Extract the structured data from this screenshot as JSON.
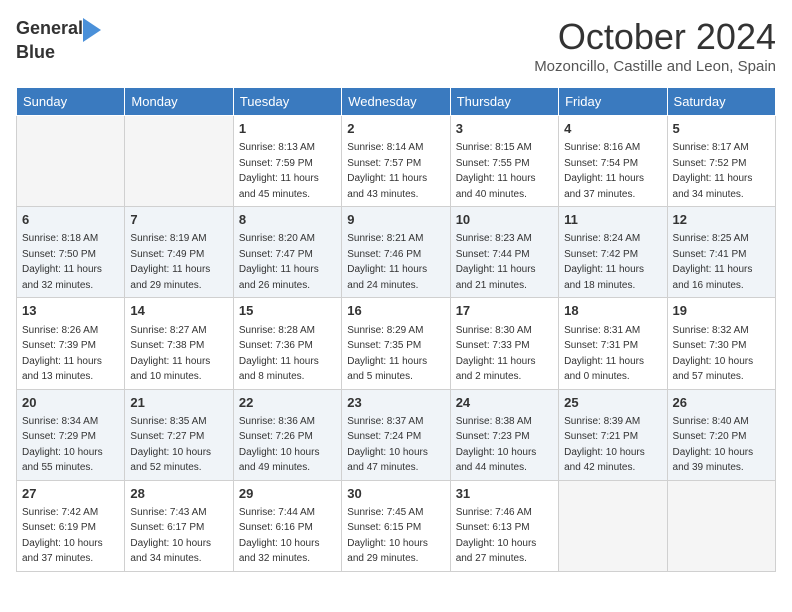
{
  "header": {
    "logo_line1": "General",
    "logo_line2": "Blue",
    "month": "October 2024",
    "location": "Mozoncillo, Castille and Leon, Spain"
  },
  "weekdays": [
    "Sunday",
    "Monday",
    "Tuesday",
    "Wednesday",
    "Thursday",
    "Friday",
    "Saturday"
  ],
  "weeks": [
    [
      {
        "day": "",
        "info": ""
      },
      {
        "day": "",
        "info": ""
      },
      {
        "day": "1",
        "info": "Sunrise: 8:13 AM\nSunset: 7:59 PM\nDaylight: 11 hours and 45 minutes."
      },
      {
        "day": "2",
        "info": "Sunrise: 8:14 AM\nSunset: 7:57 PM\nDaylight: 11 hours and 43 minutes."
      },
      {
        "day": "3",
        "info": "Sunrise: 8:15 AM\nSunset: 7:55 PM\nDaylight: 11 hours and 40 minutes."
      },
      {
        "day": "4",
        "info": "Sunrise: 8:16 AM\nSunset: 7:54 PM\nDaylight: 11 hours and 37 minutes."
      },
      {
        "day": "5",
        "info": "Sunrise: 8:17 AM\nSunset: 7:52 PM\nDaylight: 11 hours and 34 minutes."
      }
    ],
    [
      {
        "day": "6",
        "info": "Sunrise: 8:18 AM\nSunset: 7:50 PM\nDaylight: 11 hours and 32 minutes."
      },
      {
        "day": "7",
        "info": "Sunrise: 8:19 AM\nSunset: 7:49 PM\nDaylight: 11 hours and 29 minutes."
      },
      {
        "day": "8",
        "info": "Sunrise: 8:20 AM\nSunset: 7:47 PM\nDaylight: 11 hours and 26 minutes."
      },
      {
        "day": "9",
        "info": "Sunrise: 8:21 AM\nSunset: 7:46 PM\nDaylight: 11 hours and 24 minutes."
      },
      {
        "day": "10",
        "info": "Sunrise: 8:23 AM\nSunset: 7:44 PM\nDaylight: 11 hours and 21 minutes."
      },
      {
        "day": "11",
        "info": "Sunrise: 8:24 AM\nSunset: 7:42 PM\nDaylight: 11 hours and 18 minutes."
      },
      {
        "day": "12",
        "info": "Sunrise: 8:25 AM\nSunset: 7:41 PM\nDaylight: 11 hours and 16 minutes."
      }
    ],
    [
      {
        "day": "13",
        "info": "Sunrise: 8:26 AM\nSunset: 7:39 PM\nDaylight: 11 hours and 13 minutes."
      },
      {
        "day": "14",
        "info": "Sunrise: 8:27 AM\nSunset: 7:38 PM\nDaylight: 11 hours and 10 minutes."
      },
      {
        "day": "15",
        "info": "Sunrise: 8:28 AM\nSunset: 7:36 PM\nDaylight: 11 hours and 8 minutes."
      },
      {
        "day": "16",
        "info": "Sunrise: 8:29 AM\nSunset: 7:35 PM\nDaylight: 11 hours and 5 minutes."
      },
      {
        "day": "17",
        "info": "Sunrise: 8:30 AM\nSunset: 7:33 PM\nDaylight: 11 hours and 2 minutes."
      },
      {
        "day": "18",
        "info": "Sunrise: 8:31 AM\nSunset: 7:31 PM\nDaylight: 11 hours and 0 minutes."
      },
      {
        "day": "19",
        "info": "Sunrise: 8:32 AM\nSunset: 7:30 PM\nDaylight: 10 hours and 57 minutes."
      }
    ],
    [
      {
        "day": "20",
        "info": "Sunrise: 8:34 AM\nSunset: 7:29 PM\nDaylight: 10 hours and 55 minutes."
      },
      {
        "day": "21",
        "info": "Sunrise: 8:35 AM\nSunset: 7:27 PM\nDaylight: 10 hours and 52 minutes."
      },
      {
        "day": "22",
        "info": "Sunrise: 8:36 AM\nSunset: 7:26 PM\nDaylight: 10 hours and 49 minutes."
      },
      {
        "day": "23",
        "info": "Sunrise: 8:37 AM\nSunset: 7:24 PM\nDaylight: 10 hours and 47 minutes."
      },
      {
        "day": "24",
        "info": "Sunrise: 8:38 AM\nSunset: 7:23 PM\nDaylight: 10 hours and 44 minutes."
      },
      {
        "day": "25",
        "info": "Sunrise: 8:39 AM\nSunset: 7:21 PM\nDaylight: 10 hours and 42 minutes."
      },
      {
        "day": "26",
        "info": "Sunrise: 8:40 AM\nSunset: 7:20 PM\nDaylight: 10 hours and 39 minutes."
      }
    ],
    [
      {
        "day": "27",
        "info": "Sunrise: 7:42 AM\nSunset: 6:19 PM\nDaylight: 10 hours and 37 minutes."
      },
      {
        "day": "28",
        "info": "Sunrise: 7:43 AM\nSunset: 6:17 PM\nDaylight: 10 hours and 34 minutes."
      },
      {
        "day": "29",
        "info": "Sunrise: 7:44 AM\nSunset: 6:16 PM\nDaylight: 10 hours and 32 minutes."
      },
      {
        "day": "30",
        "info": "Sunrise: 7:45 AM\nSunset: 6:15 PM\nDaylight: 10 hours and 29 minutes."
      },
      {
        "day": "31",
        "info": "Sunrise: 7:46 AM\nSunset: 6:13 PM\nDaylight: 10 hours and 27 minutes."
      },
      {
        "day": "",
        "info": ""
      },
      {
        "day": "",
        "info": ""
      }
    ]
  ]
}
